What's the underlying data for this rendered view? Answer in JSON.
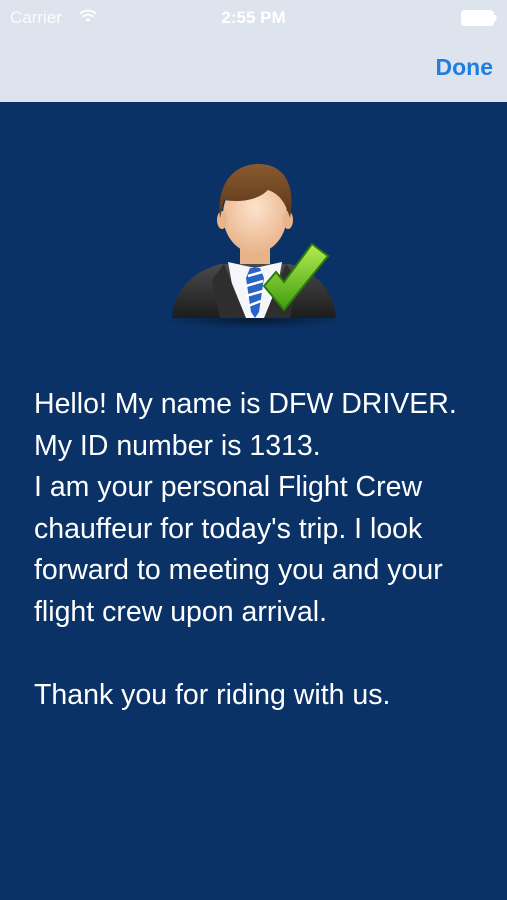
{
  "status_bar": {
    "carrier": "Carrier",
    "time": "2:55 PM",
    "wifi_icon": "wifi-icon",
    "battery_icon": "battery-icon"
  },
  "navbar": {
    "done_label": "Done"
  },
  "driver": {
    "avatar_icon": "driver-avatar-checkmark-icon",
    "message": "Hello! My name is DFW DRIVER. My ID number is 1313.\nI am your personal Flight Crew chauffeur for today's trip. I look forward to meeting you and your flight crew upon arrival.\n\nThank you for riding with us."
  },
  "colors": {
    "background": "#0a3266",
    "top_bar": "#dde4ee",
    "accent": "#1f7ee0",
    "text": "#ffffff"
  }
}
